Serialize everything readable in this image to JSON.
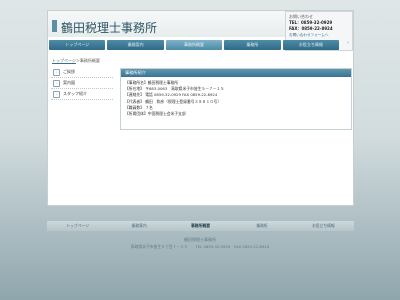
{
  "header": {
    "site_title": "鶴田税理士事務所",
    "contact": {
      "heading": "お問い合わせ",
      "tel": "TEL：0859-32-0929",
      "fax": "FAX：0859-22-8924",
      "form_link": "お問い合わせフォームへ"
    }
  },
  "nav": [
    {
      "label": "トップページ"
    },
    {
      "label": "業務案内"
    },
    {
      "label": "事務所概要"
    },
    {
      "label": "業務所"
    },
    {
      "label": "お役立ち情報"
    }
  ],
  "breadcrumb": {
    "home": "トップページ",
    "separator": "＞",
    "current": "事務所概要"
  },
  "sidebar": [
    {
      "label": "ご挨拶"
    },
    {
      "label": "案内図"
    },
    {
      "label": "スタッフ紹介"
    }
  ],
  "content": {
    "title": "事務所紹介",
    "rows": [
      "【事務所名】鶴田税理士事務所",
      "【所在地】 〒683-0063　鳥取県米子市皆生５－７－１５",
      "【連絡先】 電話 0859-32-0929 FAX 0859-22-8924",
      "【代表者】 鶴田　和彦（税理士登録番号３８８１０号）",
      "【職員数】 ７名",
      "【所属団体】中国税理士会米子支部"
    ]
  },
  "footer": {
    "nav": [
      {
        "label": "トップページ"
      },
      {
        "label": "業務案内"
      },
      {
        "label": "事務所概要"
      },
      {
        "label": "業務所"
      },
      {
        "label": "お役立ち情報"
      }
    ],
    "name": "鶴田税理士事務所",
    "address": "鳥取県米子市皆生５丁目７－１５　　TEL 0859-32-0929　FAX 0859-22-8924"
  },
  "colors": {
    "nav": "#3a7490",
    "nav_active": "#6ea3ba",
    "accent_text": "#2e5565"
  }
}
